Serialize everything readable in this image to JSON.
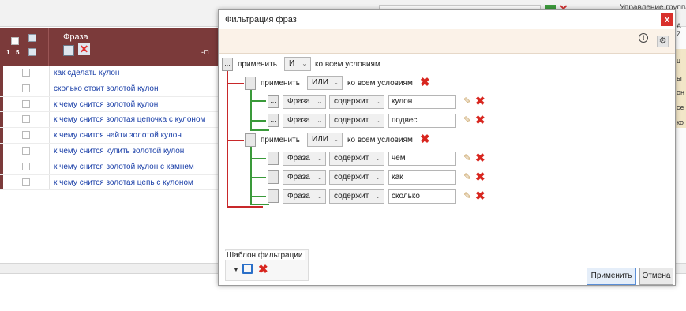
{
  "background": {
    "right_panel_title": "Управление группами",
    "right_panel_texts": [
      "А",
      "Z",
      "ц",
      "ьг",
      "он",
      "се",
      "ко"
    ],
    "grid": {
      "header_phrase": "Фраза",
      "header_small_labels": [
        "1",
        "5"
      ],
      "rows": [
        "как сделать кулон",
        "сколько стоит золотой кулон",
        "к чему снится золотой кулон",
        "к чему снится золотая цепочка с кулоном",
        "к чему снится найти золотой кулон",
        "к чему снится купить золотой кулон",
        "к чему снится золотой кулон с камнем",
        "к чему снится золотая цепь с кулоном"
      ]
    }
  },
  "dialog": {
    "title": "Фильтрация фраз",
    "close_label": "x",
    "info_label": "!",
    "gear_label": "⚙",
    "ellipsis": "...",
    "apply_word": "применить",
    "all_conditions": "ко всем условиям",
    "root_operator": "И",
    "groups": [
      {
        "operator": "ИЛИ",
        "conditions": [
          {
            "field": "Фраза",
            "op": "содержит",
            "value": "кулон"
          },
          {
            "field": "Фраза",
            "op": "содержит",
            "value": "подвес"
          }
        ]
      },
      {
        "operator": "ИЛИ",
        "conditions": [
          {
            "field": "Фраза",
            "op": "содержит",
            "value": "чем"
          },
          {
            "field": "Фраза",
            "op": "содержит",
            "value": "как"
          },
          {
            "field": "Фраза",
            "op": "содержит",
            "value": "сколько"
          }
        ]
      }
    ],
    "template_label": "Шаблон фильтрации",
    "apply_button": "Применить",
    "cancel_button": "Отмена"
  },
  "colors": {
    "grid_header": "#7b3a3a",
    "tree_red": "#c8282a",
    "tree_green": "#3a9a3a",
    "delete_red": "#d8261f",
    "link_blue": "#1a3fa8"
  }
}
